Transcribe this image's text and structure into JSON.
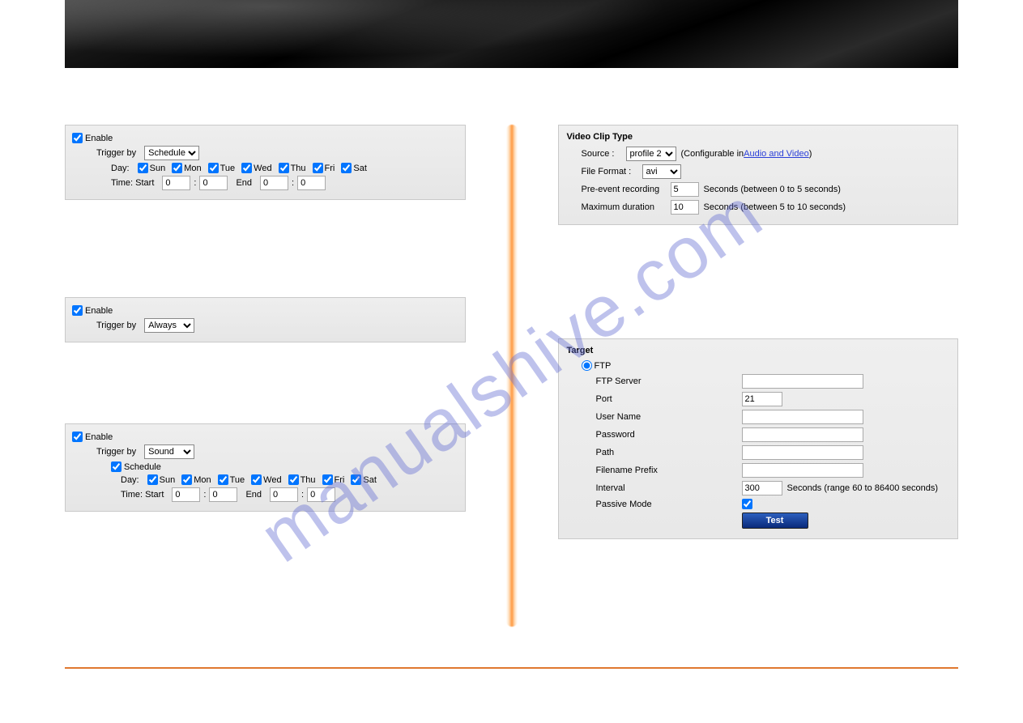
{
  "watermark": "manualshive.com",
  "days": [
    "Sun",
    "Mon",
    "Tue",
    "Wed",
    "Thu",
    "Fri",
    "Sat"
  ],
  "panel1": {
    "enable": "Enable",
    "triggerBy": "Trigger by",
    "triggerSelected": "Schedule",
    "dayLabel": "Day:",
    "timeStart": "Time: Start",
    "end": "End",
    "startH": "0",
    "startM": "0",
    "endH": "0",
    "endM": "0"
  },
  "panel2": {
    "enable": "Enable",
    "triggerBy": "Trigger by",
    "triggerSelected": "Always"
  },
  "panel3": {
    "enable": "Enable",
    "triggerBy": "Trigger by",
    "triggerSelected": "Sound",
    "schedule": "Schedule",
    "dayLabel": "Day:",
    "timeStart": "Time: Start",
    "end": "End",
    "startH": "0",
    "startM": "0",
    "endH": "0",
    "endM": "0"
  },
  "videoClip": {
    "title": "Video Clip Type",
    "source": "Source :",
    "sourceSelected": "profile 2",
    "configNoteLeft": "(Configurable in ",
    "configLink": "Audio and Video",
    "configNoteRight": ")",
    "fileFormat": "File Format :",
    "fileFormatSelected": "avi",
    "preEvent": "Pre-event recording",
    "preEventVal": "5",
    "preEventNote": "Seconds  (between 0 to 5 seconds)",
    "maxDur": "Maximum duration",
    "maxDurVal": "10",
    "maxDurNote": "Seconds  (between 5 to 10 seconds)"
  },
  "target": {
    "title": "Target",
    "ftp": "FTP",
    "ftpServer": "FTP Server",
    "ftpServerVal": "",
    "port": "Port",
    "portVal": "21",
    "userName": "User Name",
    "userNameVal": "",
    "password": "Password",
    "passwordVal": "",
    "path": "Path",
    "pathVal": "",
    "filenamePrefix": "Filename Prefix",
    "filenamePrefixVal": "",
    "interval": "Interval",
    "intervalVal": "300",
    "intervalNote": "Seconds  (range 60 to 86400 seconds)",
    "passiveMode": "Passive Mode",
    "test": "Test"
  }
}
